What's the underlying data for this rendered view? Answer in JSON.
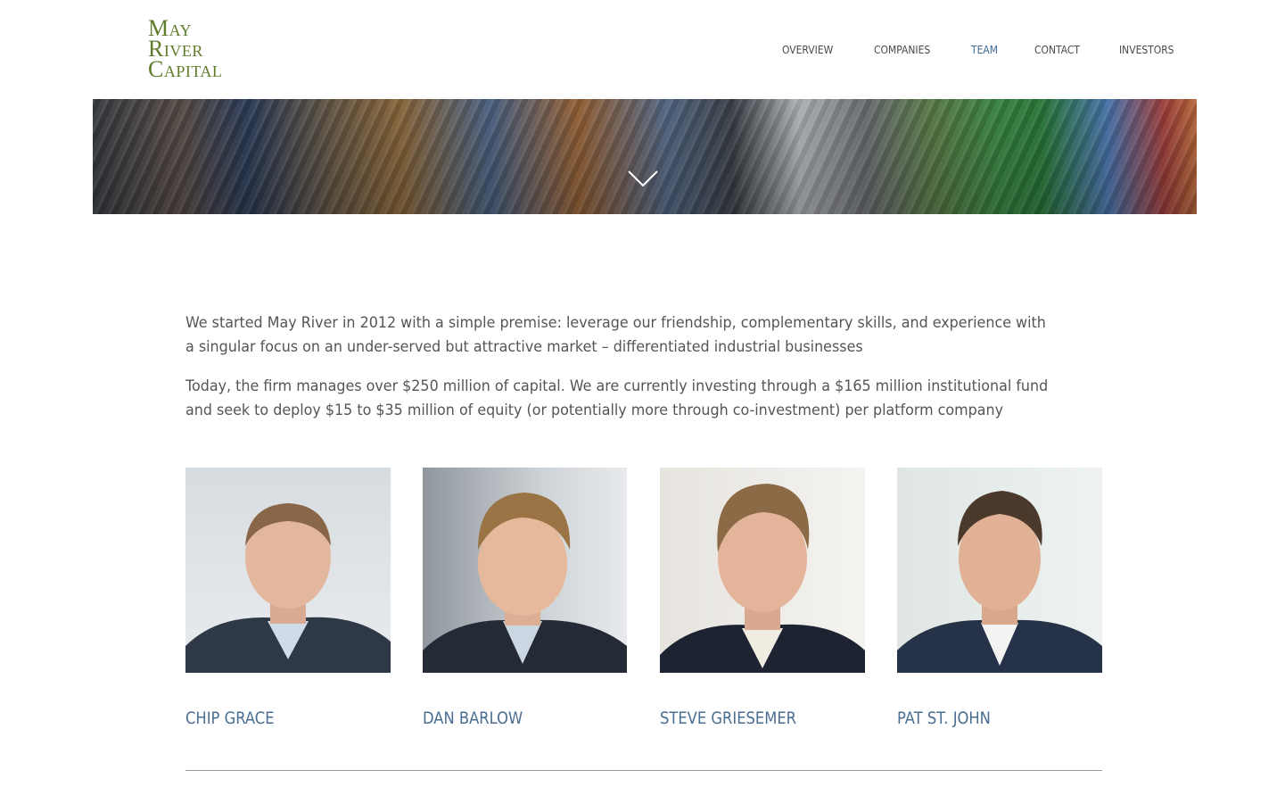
{
  "brand": {
    "lines": [
      "May",
      "River",
      "Capital"
    ],
    "color": "#5f7d2a"
  },
  "nav": {
    "items": [
      {
        "label": "OVERVIEW"
      },
      {
        "label": "COMPANIES"
      },
      {
        "label": "TEAM",
        "active": true
      },
      {
        "label": "CONTACT"
      },
      {
        "label": "INVESTORS"
      }
    ],
    "active_color": "#3e6b93"
  },
  "hero": {
    "scroll_icon": "chevron-down-icon"
  },
  "intro": {
    "paragraphs": [
      "We started May River in 2012 with a simple premise:  leverage our friendship, complementary skills, and experience with a singular focus on an under-served but attractive market – differentiated industrial businesses",
      "Today, the firm manages over $250 million of capital.  We are currently investing through a $165 million institutional fund and seek to deploy $15 to $35 million of equity (or potentially more through co-investment) per platform company"
    ]
  },
  "team": {
    "members": [
      {
        "name": "CHIP GRACE"
      },
      {
        "name": "DAN BARLOW"
      },
      {
        "name": "STEVE GRIESEMER"
      },
      {
        "name": "PAT ST. JOHN"
      }
    ],
    "name_color": "#4a6d92"
  }
}
